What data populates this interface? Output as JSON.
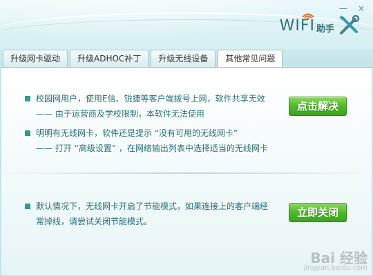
{
  "window": {
    "controls": {
      "minimize": "—",
      "close": "×"
    },
    "logo": {
      "wifi": "WIFI",
      "zh": "助手"
    }
  },
  "tabs": [
    {
      "label": "升级网卡驱动"
    },
    {
      "label": "升级ADHOC补丁"
    },
    {
      "label": "升级无线设备"
    },
    {
      "label": "其他常见问题"
    }
  ],
  "content": {
    "items": [
      {
        "line1": "校园网用户，使用E信、锐捷等客户端拨号上网，软件共享无效",
        "line2": "—— 由于运营商及学校限制，本软件无法使用"
      },
      {
        "line1": "明明有无线网卡，软件还是提示 “没有可用的无线网卡”",
        "line2": "—— 打开 “高级设置” ，在网络输出列表中选择适当的无线网卡"
      },
      {
        "line1": "默认情况下，无线网卡开启了节能模式，如果连接上的客户端经",
        "line2": "常掉线，请尝试关闭节能模式。"
      }
    ],
    "buttons": {
      "solve": "点击解决",
      "close_now": "立即关闭"
    }
  },
  "watermark": {
    "main": "Bai 经验",
    "sub": "jingyan.baidu.com"
  }
}
